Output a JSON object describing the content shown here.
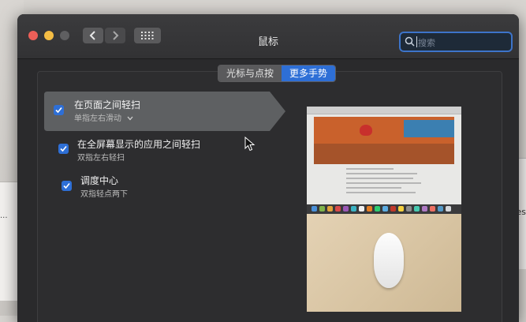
{
  "window": {
    "title": "鼠标"
  },
  "search": {
    "placeholder": "搜索"
  },
  "tabs": [
    {
      "label": "光标与点按",
      "active": false
    },
    {
      "label": "更多手势",
      "active": true
    }
  ],
  "gestures": [
    {
      "title": "在页面之间轻扫",
      "subtitle": "单指左右滑动",
      "checked": true,
      "selected": true,
      "has_dropdown": true
    },
    {
      "title": "在全屏幕显示的应用之间轻扫",
      "subtitle": "双指左右轻扫",
      "checked": true,
      "selected": false,
      "has_dropdown": false
    },
    {
      "title": "调度中心",
      "subtitle": "双指轻点两下",
      "checked": true,
      "selected": false,
      "has_dropdown": false
    }
  ],
  "background": {
    "right_window_text": "ttBlues",
    "left_window_text": "..."
  },
  "colors": {
    "accent": "#2e6fd6",
    "window_bg": "#2a2a2c",
    "selection": "#5e6062"
  },
  "icons": [
    "chevron-left-icon",
    "chevron-right-icon",
    "grid-icon",
    "search-icon",
    "checkmark-icon",
    "chevron-down-icon",
    "pointer-cursor-icon"
  ]
}
